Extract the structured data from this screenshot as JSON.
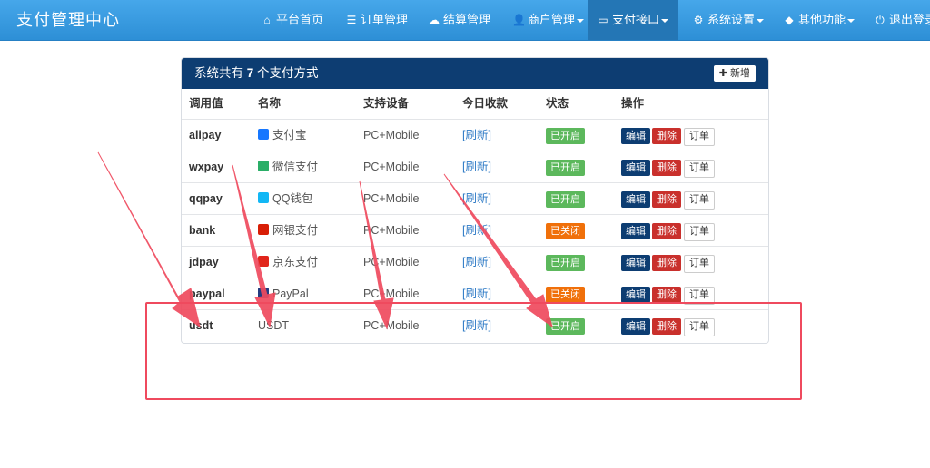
{
  "app": {
    "title": "支付管理中心"
  },
  "nav": [
    {
      "label": "平台首页",
      "icon": "home-icon",
      "glyph": "⌂"
    },
    {
      "label": "订单管理",
      "icon": "list-icon",
      "glyph": "☰"
    },
    {
      "label": "结算管理",
      "icon": "cloud-icon",
      "glyph": "☁"
    },
    {
      "label": "商户管理",
      "icon": "user-icon",
      "glyph": "👤"
    },
    {
      "label": "支付接口",
      "icon": "credit-card-icon",
      "glyph": "▭"
    },
    {
      "label": "系统设置",
      "icon": "gear-icon",
      "glyph": "⚙"
    },
    {
      "label": "其他功能",
      "icon": "cube-icon",
      "glyph": "◆"
    },
    {
      "label": "退出登录",
      "icon": "power-icon",
      "glyph": "⏻"
    }
  ],
  "panel": {
    "title_prefix": "系统共有",
    "title_count": "7",
    "title_suffix": "个支付方式",
    "add_label": "新增",
    "add_icon": "plus-icon"
  },
  "table": {
    "headers": [
      "调用值",
      "名称",
      "支持设备",
      "今日收款",
      "状态",
      "操作"
    ],
    "rows": [
      {
        "key": "alipay",
        "name": "支付宝",
        "icon": "alipay-icon",
        "icon_color": "#1677ff",
        "device": "PC+Mobile",
        "income": "[刷新]",
        "status": "已开启",
        "status_on": true
      },
      {
        "key": "wxpay",
        "name": "微信支付",
        "icon": "wechat-icon",
        "icon_color": "#2aae67",
        "device": "PC+Mobile",
        "income": "[刷新]",
        "status": "已开启",
        "status_on": true
      },
      {
        "key": "qqpay",
        "name": "QQ钱包",
        "icon": "qq-icon",
        "icon_color": "#12b7f5",
        "device": "PC+Mobile",
        "income": "[刷新]",
        "status": "已开启",
        "status_on": true
      },
      {
        "key": "bank",
        "name": "网银支付",
        "icon": "unionpay-icon",
        "icon_color": "#d81e06",
        "device": "PC+Mobile",
        "income": "[刷新]",
        "status": "已关闭",
        "status_on": false
      },
      {
        "key": "jdpay",
        "name": "京东支付",
        "icon": "jd-icon",
        "icon_color": "#e1251b",
        "device": "PC+Mobile",
        "income": "[刷新]",
        "status": "已开启",
        "status_on": true
      },
      {
        "key": "paypal",
        "name": "PayPal",
        "icon": "paypal-icon",
        "icon_color": "#253b80",
        "device": "PC+Mobile",
        "income": "[刷新]",
        "status": "已关闭",
        "status_on": false
      },
      {
        "key": "usdt",
        "name": "USDT",
        "icon": "",
        "icon_color": "",
        "device": "PC+Mobile",
        "income": "[刷新]",
        "status": "已开启",
        "status_on": true
      }
    ],
    "actions": {
      "edit": "编辑",
      "delete": "删除",
      "orders": "订单"
    }
  },
  "colors": {
    "navbar": "#3a9be0",
    "panel_header": "#0d3d72",
    "status_on": "#5cb85c",
    "status_off": "#f0700a",
    "delete": "#c9302c",
    "annotation": "#ef4a5e"
  }
}
